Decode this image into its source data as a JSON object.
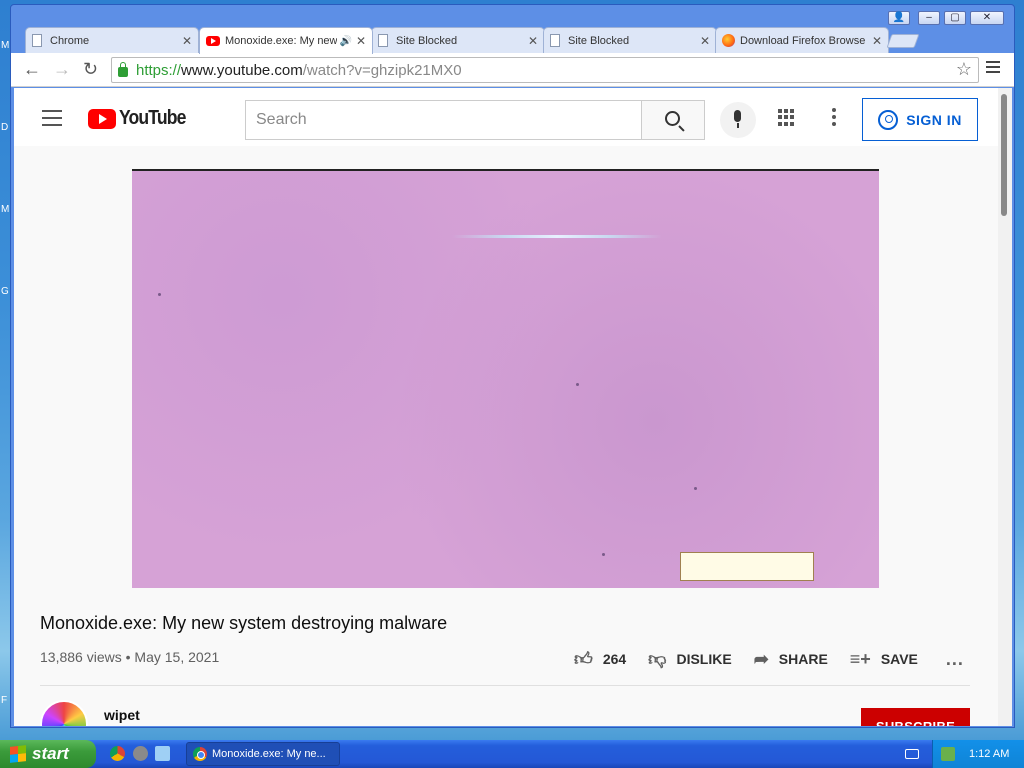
{
  "desktop": {
    "side_letters": [
      "M",
      "D",
      "M",
      "G",
      "F"
    ]
  },
  "browser": {
    "tabs": [
      {
        "title": "Chrome",
        "icon": "doc-icon",
        "active": false
      },
      {
        "title": "Monoxide.exe: My new",
        "icon": "youtube-icon",
        "active": true
      },
      {
        "title": "Site Blocked",
        "icon": "doc-icon",
        "active": false
      },
      {
        "title": "Site Blocked",
        "icon": "doc-icon",
        "active": false
      },
      {
        "title": "Download Firefox Browse",
        "icon": "firefox-icon",
        "active": false
      }
    ],
    "url": {
      "scheme": "https://",
      "host": "www.youtube.com",
      "path": "/watch?v=ghzipk21MX0"
    }
  },
  "youtube": {
    "logo_text": "YouTube",
    "search_placeholder": "Search",
    "sign_in": "SIGN IN",
    "video": {
      "title": "Monoxide.exe: My new system destroying malware",
      "views": "13,886 views",
      "separator": "•",
      "date": "May 15, 2021",
      "likes": "264",
      "dislike_label": "DISLIKE",
      "share_label": "SHARE",
      "save_label": "SAVE",
      "more_label": "..."
    },
    "channel": {
      "name": "wipet",
      "subscribe_label": "SUBSCRIBE"
    }
  },
  "taskbar": {
    "start_label": "start",
    "task_title": "Monoxide.exe: My ne...",
    "clock": "1:12 AM"
  }
}
